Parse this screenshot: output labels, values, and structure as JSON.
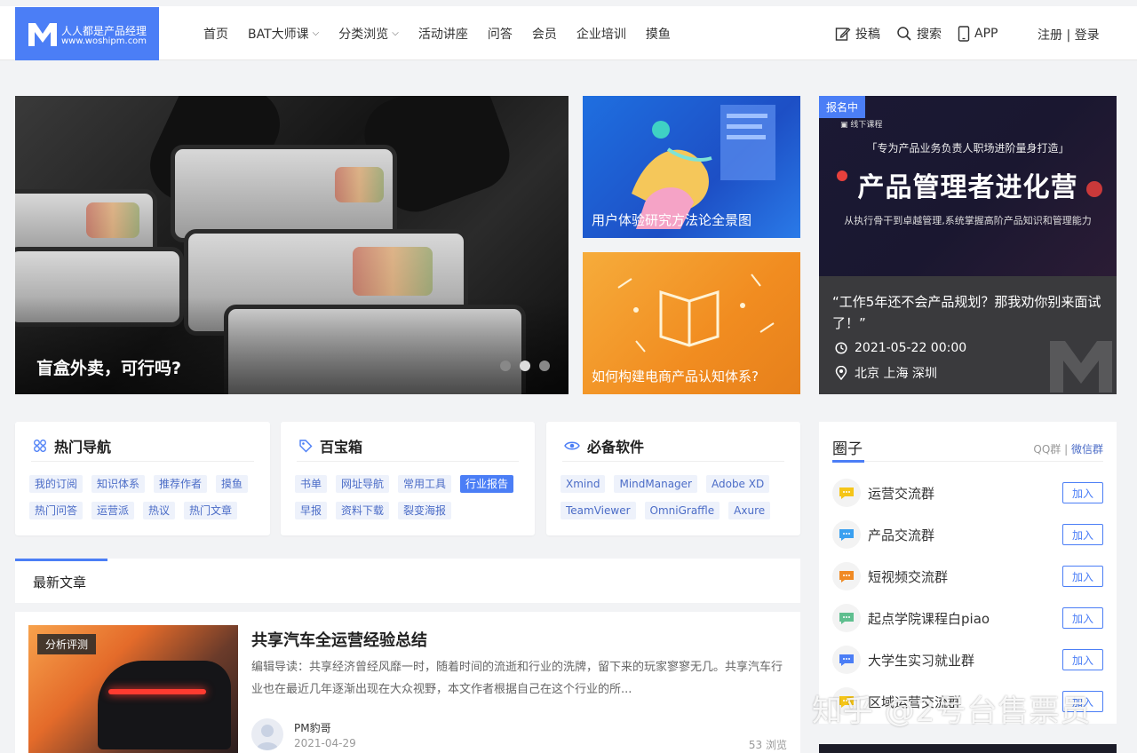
{
  "logo": {
    "title": "人人都是产品经理",
    "url": "www.woshipm.com"
  },
  "nav": [
    {
      "label": "首页",
      "dropdown": false
    },
    {
      "label": "BAT大师课",
      "dropdown": true
    },
    {
      "label": "分类浏览",
      "dropdown": true
    },
    {
      "label": "活动讲座",
      "dropdown": false
    },
    {
      "label": "问答",
      "dropdown": false
    },
    {
      "label": "会员",
      "dropdown": false
    },
    {
      "label": "企业培训",
      "dropdown": false
    },
    {
      "label": "摸鱼",
      "dropdown": false
    }
  ],
  "tools": {
    "contribute": "投稿",
    "search": "搜索",
    "app": "APP"
  },
  "auth": "注册 | 登录",
  "hero": {
    "title": "盲盒外卖，可行吗?",
    "slides": 3,
    "active_slide": 2
  },
  "cards": {
    "blue": "用户体验研究方法论全景图",
    "orange": "如何构建电商产品认知体系?"
  },
  "course": {
    "badge": "报名中",
    "tag": "线下课程",
    "sub": "「专为产品业务负责人职场进阶量身打造」",
    "big": "产品管理者进化营",
    "desc": "从执行骨干到卓越管理,系统掌握高阶产品知识和管理能力",
    "quote": "“工作5年还不会产品规划？那我劝你别来面试了！”",
    "date": "2021-05-22 00:00",
    "location": "北京 上海 深圳"
  },
  "panels": {
    "hot": {
      "title": "热门导航",
      "tags": [
        "我的订阅",
        "知识体系",
        "推荐作者",
        "摸鱼",
        "热门问答",
        "运营派",
        "热议",
        "热门文章"
      ]
    },
    "toolbox": {
      "title": "百宝箱",
      "tags": [
        "书单",
        "网址导航",
        "常用工具",
        "行业报告",
        "早报",
        "资料下载",
        "裂变海报"
      ],
      "active": "行业报告"
    },
    "software": {
      "title": "必备软件",
      "tags": [
        "Xmind",
        "MindManager",
        "Adobe XD",
        "TeamViewer",
        "OmniGraffle",
        "Axure"
      ]
    }
  },
  "latest": {
    "label": "最新文章"
  },
  "article": {
    "category": "分析评测",
    "title": "共享汽车全运营经验总结",
    "excerpt": "编辑导读：共享经济曾经风靡一时，随着时间的流逝和行业的洗牌，留下来的玩家寥寥无几。共享汽车行业也在最近几年逐渐出现在大众视野，本文作者根据自己在这个行业的所...",
    "author": "PM豹哥",
    "date": "2021-04-29",
    "views": "53 浏览"
  },
  "circle": {
    "title": "圈子",
    "qq": "QQ群",
    "sep": " | ",
    "wechat": "微信群",
    "join_label": "加入",
    "groups": [
      {
        "name": "运营交流群",
        "color": "#f5c518"
      },
      {
        "name": "产品交流群",
        "color": "#3aa0f0"
      },
      {
        "name": "短视频交流群",
        "color": "#f08a24"
      },
      {
        "name": "起点学院课程白piao",
        "color": "#5fbf8f"
      },
      {
        "name": "大学生实习就业群",
        "color": "#4b7ef6"
      },
      {
        "name": "区域运营交流群",
        "color": "#f5c518"
      }
    ]
  },
  "watermark": "知乎 @2号台售票员"
}
